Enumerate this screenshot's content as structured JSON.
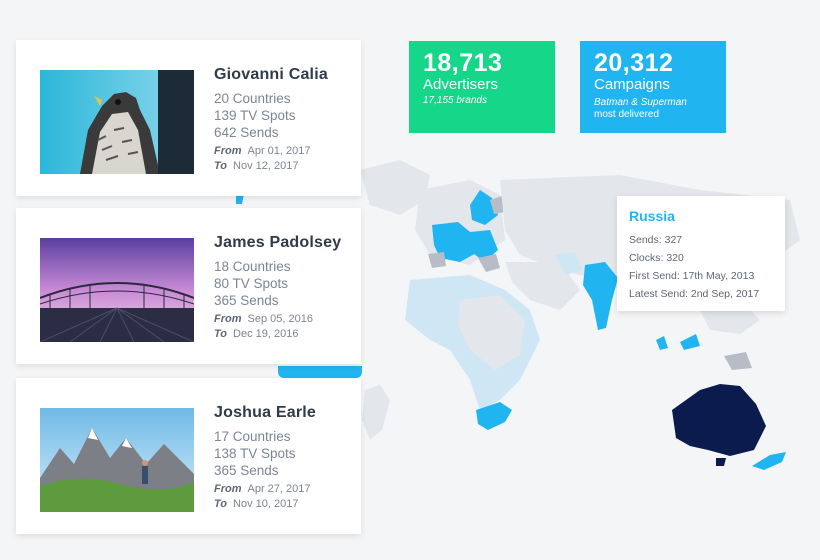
{
  "cards": [
    {
      "name": "Giovanni Calia",
      "countries": "20 Countries",
      "spots": "139 TV Spots",
      "sends": "642 Sends",
      "from_label": "From",
      "from_date": "Apr 01, 2017",
      "to_label": "To",
      "to_date": "Nov 12, 2017"
    },
    {
      "name": "James Padolsey",
      "countries": "18 Countries",
      "spots": "80 TV Spots",
      "sends": "365 Sends",
      "from_label": "From",
      "from_date": "Sep 05, 2016",
      "to_label": "To",
      "to_date": "Dec 19, 2016"
    },
    {
      "name": "Joshua Earle",
      "countries": "17 Countries",
      "spots": "138 TV Spots",
      "sends": "365 Sends",
      "from_label": "From",
      "from_date": "Apr 27, 2017",
      "to_label": "To",
      "to_date": "Nov 10, 2017"
    }
  ],
  "stats": {
    "advertisers": {
      "value": "18,713",
      "label": "Advertisers",
      "sub": "17,155 brands",
      "color": "#16d68a"
    },
    "campaigns": {
      "value": "20,312",
      "label": "Campaigns",
      "sub": "Batman & Superman",
      "sub2": "most delivered",
      "color": "#20b5f0"
    }
  },
  "tooltip": {
    "country": "Russia",
    "sends": "Sends: 327",
    "clocks": "Clocks: 320",
    "first_send": "First Send: 17th May, 2013",
    "latest_send": "Latest Send: 2nd Sep, 2017"
  },
  "colors": {
    "highlight": "#20b5f0",
    "light": "#cfe6f5",
    "grey": "#b7bdc6",
    "land": "#e3e6ea",
    "dark": "#0b1b4d"
  }
}
